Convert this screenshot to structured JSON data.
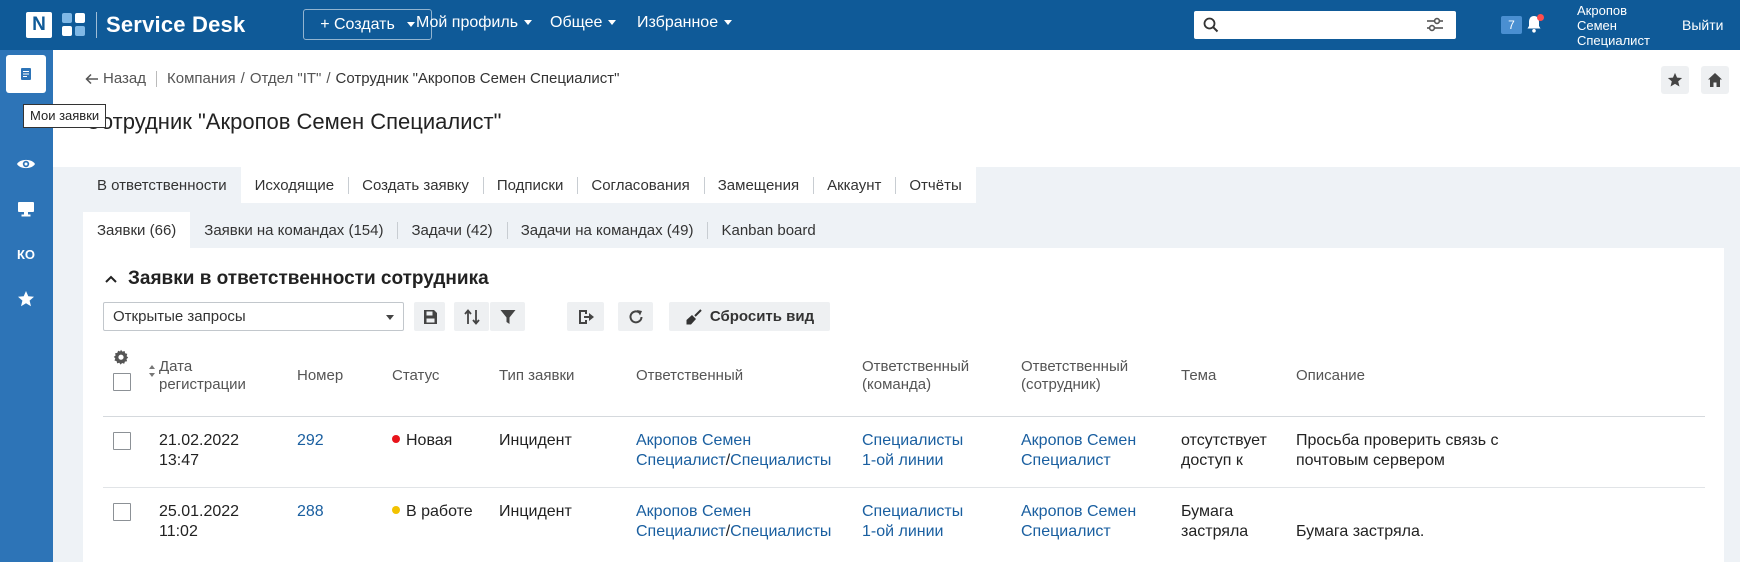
{
  "app": {
    "logo_letter": "N",
    "name": "Service Desk"
  },
  "topnav": {
    "create_label": "+ Создать",
    "my_profile": "Мой профиль",
    "general": "Общее",
    "favorites": "Избранное",
    "search_placeholder": "",
    "notifications_count": "7",
    "user_name_line1": "Акропов",
    "user_name_line2": "Семен",
    "user_name_line3": "Специалист",
    "logout": "Выйти"
  },
  "sidebar": {
    "items": [
      "my-requests",
      "list",
      "watch",
      "monitor",
      "ko",
      "favorites"
    ],
    "ko_label": "КО",
    "tooltip": "Мои заявки"
  },
  "breadcrumb": {
    "back": "Назад",
    "company": "Компания",
    "department": "Отдел \"IT\"",
    "current": "Сотрудник \"Акропов Семен Специалист\""
  },
  "page": {
    "title": "Сотрудник \"Акропов Семен Специалист\""
  },
  "tabs": [
    "В ответственности",
    "Исходящие",
    "Создать заявку",
    "Подписки",
    "Согласования",
    "Замещения",
    "Аккаунт",
    "Отчёты"
  ],
  "subtabs": [
    "Заявки (66)",
    "Заявки на командах (154)",
    "Задачи (42)",
    "Задачи на командах (49)",
    "Kanban board"
  ],
  "panel": {
    "title": "Заявки в ответственности сотрудника",
    "filter_value": "Открытые запросы",
    "reset_view": "Сбросить вид"
  },
  "table": {
    "headers": {
      "date": [
        "Дата",
        "регистрации"
      ],
      "number": "Номер",
      "status": "Статус",
      "type": "Тип заявки",
      "responsible": "Ответственный",
      "resp_team": [
        "Ответственный",
        "(команда)"
      ],
      "resp_employee": [
        "Ответственный",
        "(сотрудник)"
      ],
      "topic": "Тема",
      "description": "Описание"
    },
    "rows": [
      {
        "date": [
          "21.02.2022",
          "13:47"
        ],
        "number": "292",
        "status": "Новая",
        "status_color": "#e8141b",
        "type": "Инцидент",
        "responsible_a": "Акропов Семен",
        "responsible_b": "Специалист",
        "responsible_c": "Специалисты",
        "resp_team": [
          "Специалисты",
          "1-ой линии"
        ],
        "resp_employee": [
          "Акропов Семен",
          "Специалист"
        ],
        "topic": [
          "отсутствует",
          "доступ к"
        ],
        "description": [
          "Просьба проверить связь с",
          "почтовым сервером"
        ]
      },
      {
        "date": [
          "25.01.2022",
          "11:02"
        ],
        "number": "288",
        "status": "В работе",
        "status_color": "#f2c200",
        "type": "Инцидент",
        "responsible_a": "Акропов Семен",
        "responsible_b": "Специалист",
        "responsible_c": "Специалисты",
        "resp_team": [
          "Специалисты",
          "1-ой линии"
        ],
        "resp_employee": [
          "Акропов Семен",
          "Специалист"
        ],
        "topic": [
          "Бумага",
          "застряла"
        ],
        "description": [
          "",
          "Бумага застряла."
        ]
      }
    ]
  },
  "colors": {
    "topbar": "#0f5a98",
    "sidebar": "#2d74b7",
    "link": "#1a5fa0",
    "band": "#eef2f6"
  }
}
